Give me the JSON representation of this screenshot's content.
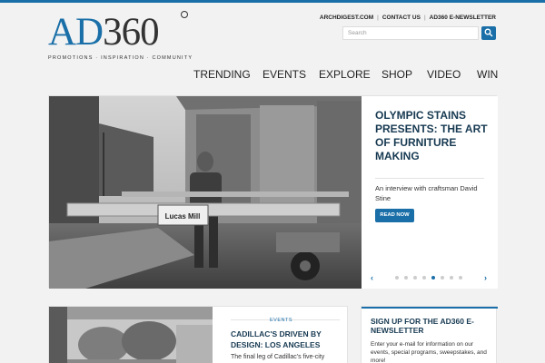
{
  "logo": {
    "text_a": "AD",
    "text_b": "360",
    "tagline": "PROMOTIONS · INSPIRATION · COMMUNITY"
  },
  "util_links": [
    "ARCHDIGEST.COM",
    "CONTACT US",
    "AD360 E-NEWSLETTER"
  ],
  "search": {
    "placeholder": "Search"
  },
  "nav": [
    "TRENDING",
    "EVENTS",
    "EXPLORE",
    "SHOP",
    "VIDEO",
    "WIN"
  ],
  "hero": {
    "title": "OLYMPIC STAINS PRESENTS: THE ART OF FURNITURE MAKING",
    "description": "An interview with craftsman David Stine",
    "button": "READ NOW",
    "photo_sign": "Lucas Mill",
    "prev": "‹",
    "next": "›",
    "slide_count": 8,
    "active_slide": 4
  },
  "card1": {
    "category": "EVENTS",
    "title": "CADILLAC'S DRIVEN BY DESIGN: LOS ANGELES",
    "description": "The final leg of Cadillac's five-city"
  },
  "card2": {
    "title": "SIGN UP FOR THE AD360 E-NEWSLETTER",
    "description": "Enter your e-mail for information on our events, special programs, sweepstakes, and more!"
  },
  "colors": {
    "accent": "#1a6fa8",
    "title_navy": "#173a52"
  }
}
